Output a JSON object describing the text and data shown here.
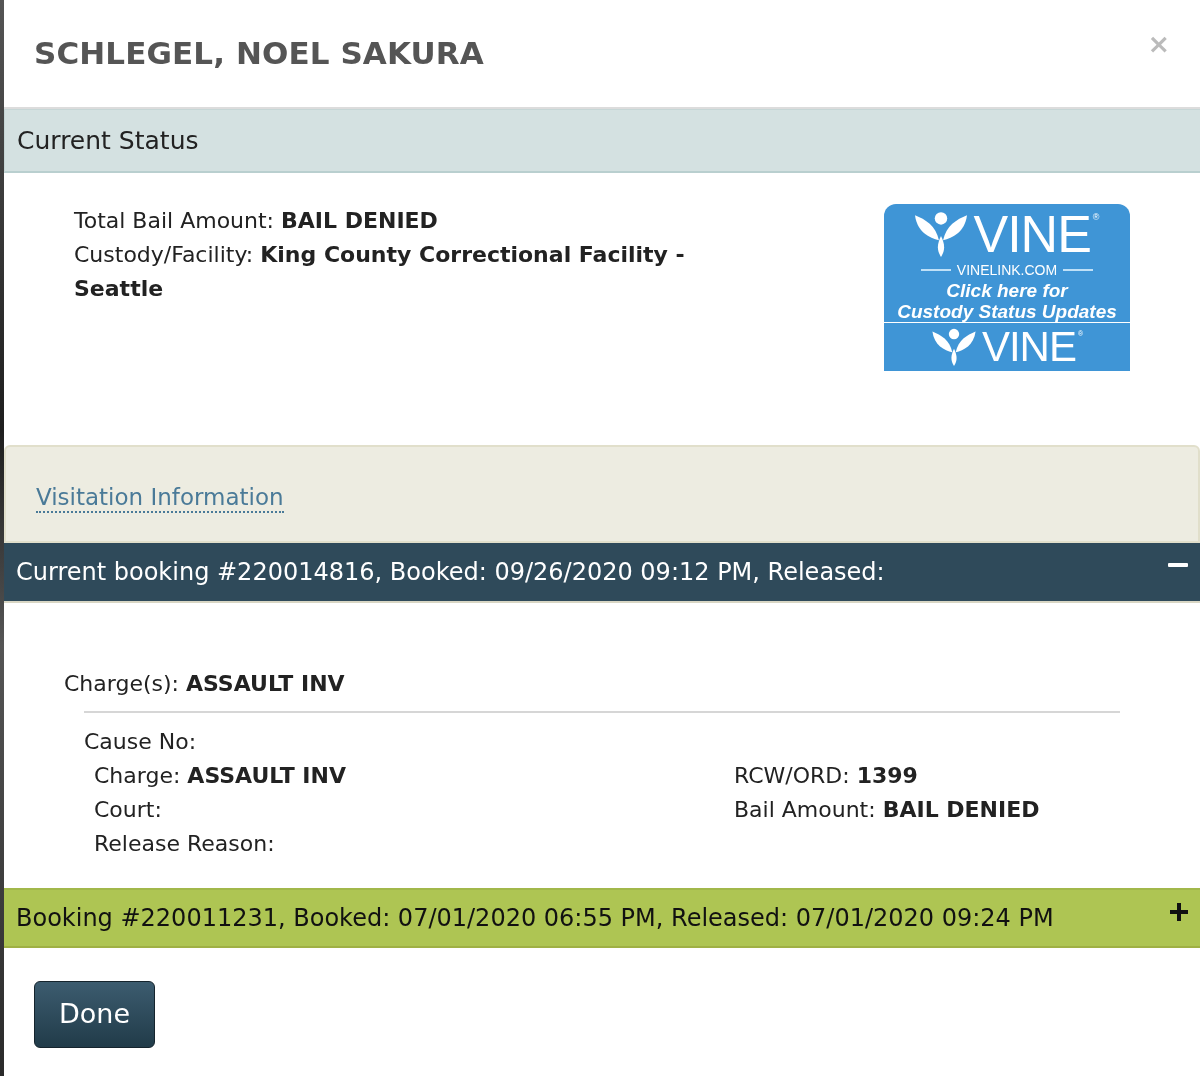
{
  "modal": {
    "title": "SCHLEGEL, NOEL SAKURA",
    "close": "×"
  },
  "current_status": {
    "heading": "Current Status",
    "fields": [
      {
        "label": "Total Bail Amount:",
        "value": "BAIL DENIED"
      },
      {
        "label": "Custody/Facility:",
        "value": "King County Correctional Facility - Seattle"
      }
    ]
  },
  "vine_banner": {
    "brand": "VINE$^{®}$",
    "site": "VINELINK.COM",
    "call_to_action": "Click here for\nCustody Status Updates",
    "footer_brand": "VINE$^{®}$"
  },
  "visitation": {
    "link": "Visitation Information"
  },
  "bookings": [
    {
      "title": "Current booking #220014816, Booked: 09/26/2020 09:12 PM, Released:",
      "expanded": true,
      "charges_summary": {
        "label": "Charge(s):",
        "value": "ASSAULT INV"
      },
      "cause_no": {
        "label": "Cause No:"
      },
      "details_left": [
        {
          "label": "Charge:",
          "value": "ASSAULT INV"
        },
        {
          "label": "Court:"
        },
        {
          "label": "Release Reason:"
        }
      ],
      "details_right": [
        {
          "label": "RCW/ORD:",
          "value": "1399"
        },
        {
          "label": "Bail Amount:",
          "value": "BAIL DENIED"
        }
      ]
    },
    {
      "title": "Booking #220011231, Booked: 07/01/2020 06:55 PM, Released: 07/01/2020 09:24 PM",
      "expanded": false
    }
  ],
  "footer": {
    "button": "Done"
  }
}
